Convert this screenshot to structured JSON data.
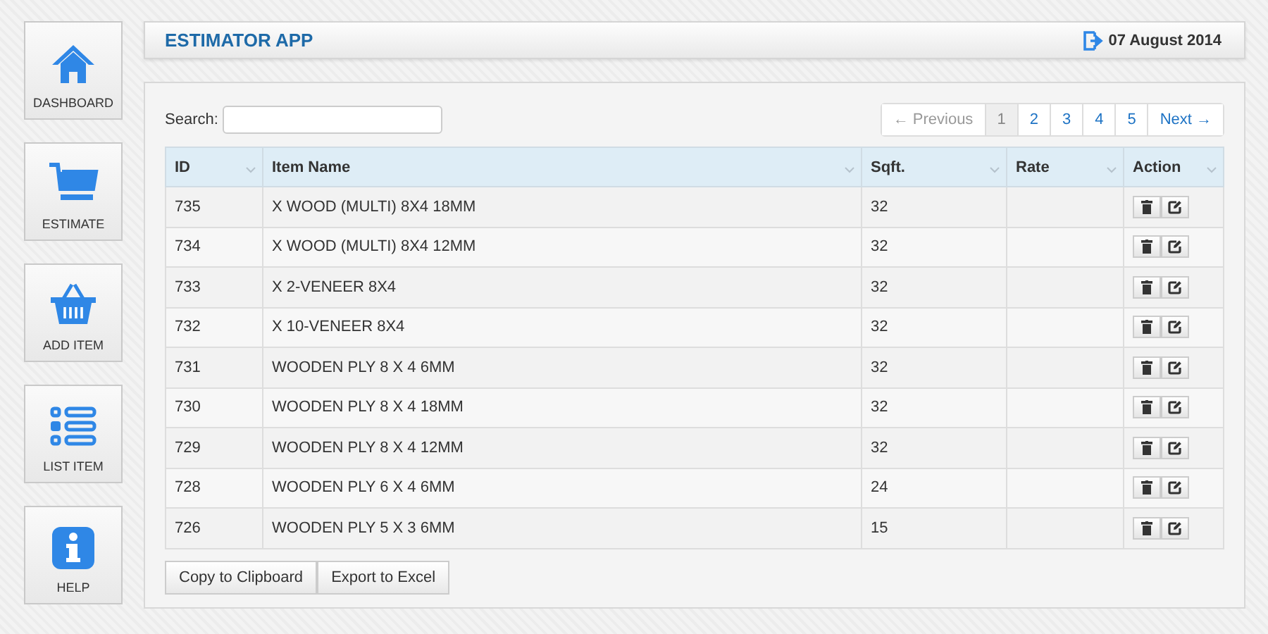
{
  "sidebar": {
    "items": [
      {
        "label": "DASHBOARD"
      },
      {
        "label": "ESTIMATE"
      },
      {
        "label": "ADD ITEM"
      },
      {
        "label": "LIST ITEM"
      },
      {
        "label": "HELP"
      }
    ]
  },
  "header": {
    "title": "ESTIMATOR APP",
    "date": "07 August 2014"
  },
  "search": {
    "label": "Search:"
  },
  "pagination": [
    {
      "label": "← Previous",
      "selected": false,
      "disabled": true
    },
    {
      "label": "1",
      "selected": true,
      "disabled": false
    },
    {
      "label": "2",
      "selected": false,
      "disabled": false
    },
    {
      "label": "3",
      "selected": false,
      "disabled": false
    },
    {
      "label": "4",
      "selected": false,
      "disabled": false
    },
    {
      "label": "5",
      "selected": false,
      "disabled": false
    },
    {
      "label": "Next →",
      "selected": false,
      "disabled": false
    }
  ],
  "table": {
    "columns": [
      "ID",
      "Item Name",
      "Sqft.",
      "Rate",
      "Action"
    ],
    "rows": [
      {
        "id": "735",
        "name": "X WOOD (MULTI) 8X4 18MM",
        "sqft": "32"
      },
      {
        "id": "734",
        "name": "X WOOD (MULTI) 8X4 12MM",
        "sqft": "32"
      },
      {
        "id": "733",
        "name": "X 2-VENEER 8X4",
        "sqft": "32"
      },
      {
        "id": "732",
        "name": "X 10-VENEER 8X4",
        "sqft": "32"
      },
      {
        "id": "731",
        "name": "WOODEN PLY 8 X 4 6MM",
        "sqft": "32"
      },
      {
        "id": "730",
        "name": "WOODEN PLY 8 X 4 18MM",
        "sqft": "32"
      },
      {
        "id": "729",
        "name": "WOODEN PLY 8 X 4 12MM",
        "sqft": "32"
      },
      {
        "id": "728",
        "name": "WOODEN PLY 6 X 4 6MM",
        "sqft": "24"
      },
      {
        "id": "726",
        "name": "WOODEN PLY 5 X 3 6MM",
        "sqft": "15"
      }
    ]
  },
  "buttons": [
    "Copy to Clipboard",
    "Export to Excel"
  ]
}
